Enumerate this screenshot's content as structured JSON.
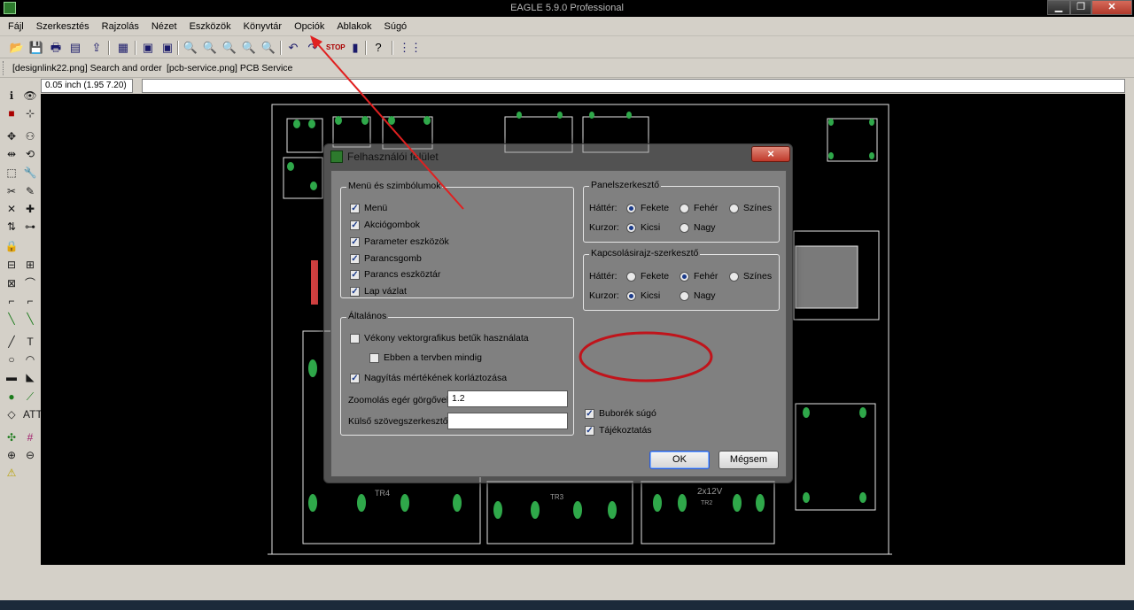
{
  "window": {
    "title": "EAGLE 5.9.0 Professional"
  },
  "menubar": [
    "Fájl",
    "Szerkesztés",
    "Rajzolás",
    "Nézet",
    "Eszközök",
    "Könyvtár",
    "Opciók",
    "Ablakok",
    "Súgó"
  ],
  "linkbar": {
    "links": [
      "[designlink22.png] Search and order",
      "[pcb-service.png] PCB Service"
    ]
  },
  "coord": {
    "value": "0.05 inch (1.95 7.20)"
  },
  "pcb": {
    "labels": {
      "tr4": "TR4",
      "tr3": "TR3",
      "tr2": "TR2",
      "voltage": "2x12V"
    }
  },
  "dialog": {
    "title": "Felhasználói felület",
    "close_label": "×",
    "menus_group": {
      "legend": "Menü és szimbólumok",
      "items": [
        {
          "label": "Menü",
          "checked": true
        },
        {
          "label": "Akciógombok",
          "checked": true
        },
        {
          "label": "Parameter eszközök",
          "checked": true
        },
        {
          "label": "Parancsgomb",
          "checked": true
        },
        {
          "label": "Parancs eszköztár",
          "checked": true
        },
        {
          "label": "Lap vázlat",
          "checked": true
        }
      ]
    },
    "general_group": {
      "legend": "Általános",
      "thin_vector": {
        "label": "Vékony vektorgrafikus betűk használata",
        "checked": false
      },
      "always_design": {
        "label": "Ebben a tervben mindig",
        "checked": false
      },
      "limit_zoom": {
        "label": "Nagyítás mértékének korláztozása",
        "checked": true
      },
      "zoom_wheel_label": "Zoomolás egér görgővel",
      "zoom_wheel_value": "1.2",
      "external_editor_label": "Külső szövegszerkesztő",
      "external_editor_value": ""
    },
    "panel_editor": {
      "legend": "Panelszerkesztő",
      "background_label": "Háttér:",
      "background_options": [
        "Fekete",
        "Fehér",
        "Színes"
      ],
      "background_selected": "Fekete",
      "cursor_label": "Kurzor:",
      "cursor_options": [
        "Kicsi",
        "Nagy"
      ],
      "cursor_selected": "Kicsi"
    },
    "schematic_editor": {
      "legend": "Kapcsolásirajz-szerkesztő",
      "background_label": "Háttér:",
      "background_options": [
        "Fekete",
        "Fehér",
        "Színes"
      ],
      "background_selected": "Fehér",
      "cursor_label": "Kurzor:",
      "cursor_options": [
        "Kicsi",
        "Nagy"
      ],
      "cursor_selected": "Kicsi"
    },
    "bubble_help": {
      "label": "Buborék súgó",
      "checked": true
    },
    "info": {
      "label": "Tájékoztatás",
      "checked": true
    },
    "ok_label": "OK",
    "cancel_label": "Mégsem"
  },
  "annotations": {
    "arrow_color": "#e02020",
    "ellipse_color": "#c0141b"
  },
  "colors": {
    "pad_green": "#2fa84a",
    "canvas": "#000000",
    "outline": "#e6e6e6"
  }
}
